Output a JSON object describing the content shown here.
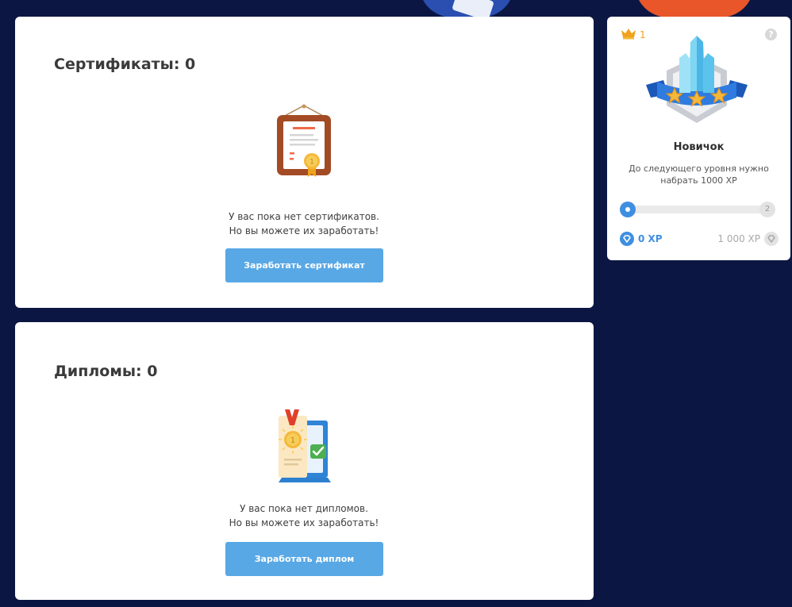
{
  "certificates": {
    "title": "Сертификаты: 0",
    "empty_line1": "У вас пока нет сертификатов.",
    "empty_line2": "Но вы можете их заработать!",
    "button_label": "Заработать сертификат",
    "icon": "certificate-icon"
  },
  "diplomas": {
    "title": "Дипломы: 0",
    "empty_line1": "У вас пока нет дипломов.",
    "empty_line2": "Но вы можете их заработать!",
    "button_label": "Заработать диплом",
    "icon": "diploma-icon"
  },
  "level": {
    "crown_count": "1",
    "help_label": "?",
    "name": "Новичок",
    "description": "До следующего уровня нужно набрать 1000 XP",
    "next_level": "2",
    "progress_fraction": 0.0,
    "xp_current": "0 XP",
    "xp_target": "1 000 XP"
  },
  "colors": {
    "background": "#0b1742",
    "accent": "#58a8e6",
    "progress": "#3f8fe0",
    "crown": "#f0a21e"
  }
}
